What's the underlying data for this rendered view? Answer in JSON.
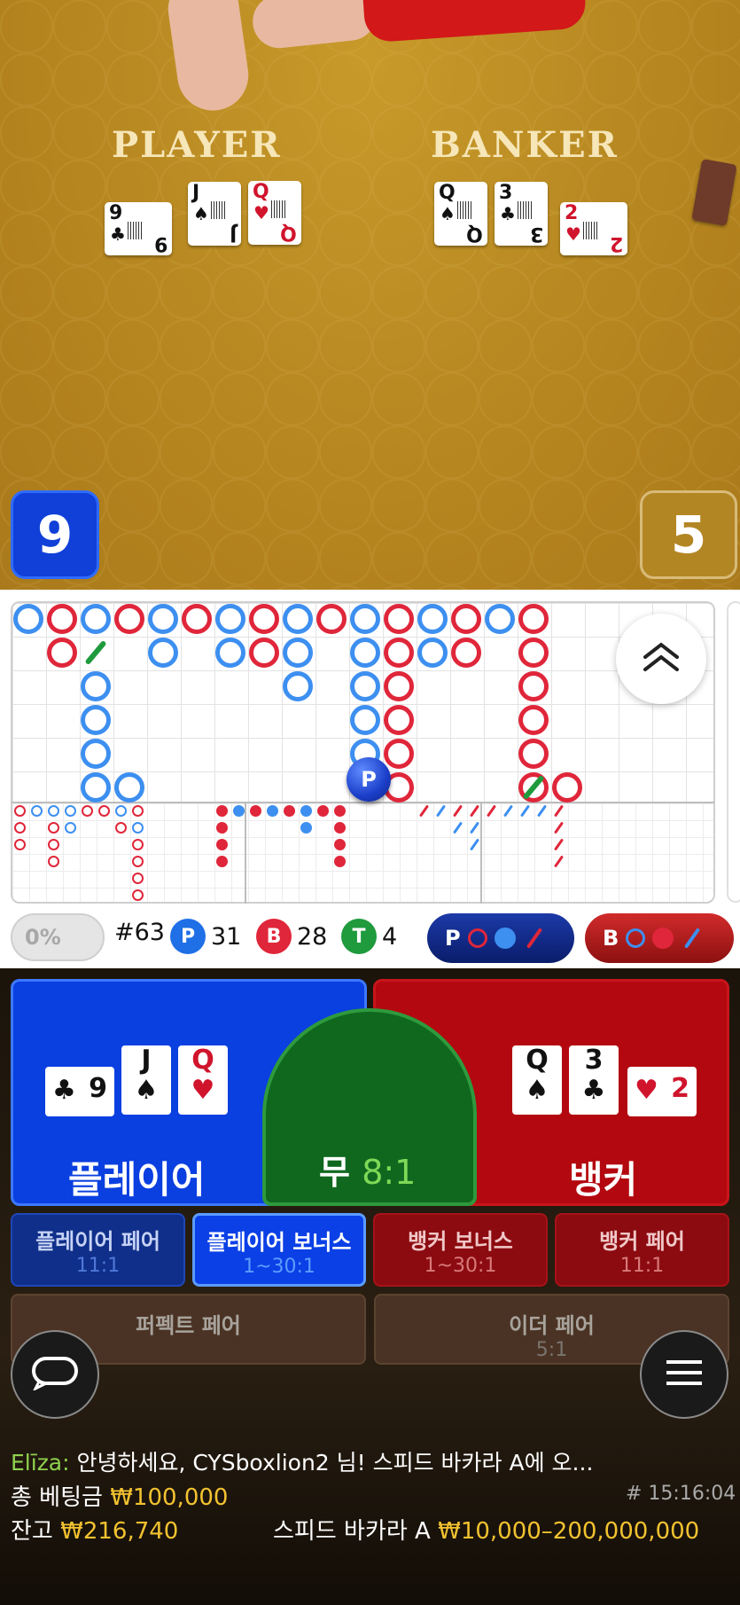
{
  "table": {
    "player_label": "PLAYER",
    "banker_label": "BANKER",
    "player_score": "9",
    "banker_score": "5",
    "player_cards": [
      {
        "rank": "9",
        "suit": "♣",
        "color": "black"
      },
      {
        "rank": "J",
        "suit": "♠",
        "color": "black"
      },
      {
        "rank": "Q",
        "suit": "♥",
        "color": "red"
      }
    ],
    "banker_cards": [
      {
        "rank": "Q",
        "suit": "♠",
        "color": "black"
      },
      {
        "rank": "3",
        "suit": "♣",
        "color": "black"
      },
      {
        "rank": "2",
        "suit": "♥",
        "color": "red"
      }
    ]
  },
  "roadmap": {
    "marker_label": "P",
    "expand_icon": "double-chevron-up-icon"
  },
  "stats": {
    "percent": "0%",
    "round": "#63",
    "player_letter": "P",
    "player_count": "31",
    "banker_letter": "B",
    "banker_count": "28",
    "tie_letter": "T",
    "tie_count": "4",
    "predict_player_label": "P",
    "predict_banker_label": "B",
    "colors": {
      "player": "#1f6fe6",
      "banker": "#e0263a",
      "tie": "#1f9a3c"
    }
  },
  "bets": {
    "player": "플레이어",
    "tie": "무",
    "tie_odds": "8:1",
    "banker": "뱅커",
    "player_cards": [
      {
        "rank": "9",
        "suit": "♣",
        "color": "black"
      },
      {
        "rank": "J",
        "suit": "♠",
        "color": "black"
      },
      {
        "rank": "Q",
        "suit": "♥",
        "color": "red"
      }
    ],
    "banker_cards": [
      {
        "rank": "Q",
        "suit": "♠",
        "color": "black"
      },
      {
        "rank": "3",
        "suit": "♣",
        "color": "black"
      },
      {
        "rank": "2",
        "suit": "♥",
        "color": "red"
      }
    ],
    "side_bets": [
      {
        "label": "플레이어 페어",
        "odds": "11:1"
      },
      {
        "label": "플레이어 보너스",
        "odds": "1~30:1"
      },
      {
        "label": "뱅커 보너스",
        "odds": "1~30:1"
      },
      {
        "label": "뱅커 페어",
        "odds": "11:1"
      }
    ],
    "perfect_pair": {
      "label": "퍼펙트 페어",
      "odds": ""
    },
    "either_pair": {
      "label": "이더 페어",
      "odds": "5:1"
    }
  },
  "chat": {
    "sender": "Elīza:",
    "message": "안녕하세요, CYSboxlion2 님! 스피드 바카라 A에 오..."
  },
  "footer": {
    "total_bet_label": "총 베팅금",
    "total_bet_value": "₩100,000",
    "game_id": "# 15:16:04",
    "balance_label": "잔고",
    "balance_value": "₩216,740",
    "table_name": "스피드 바카라 A",
    "limits": "₩10,000–200,000,000"
  }
}
